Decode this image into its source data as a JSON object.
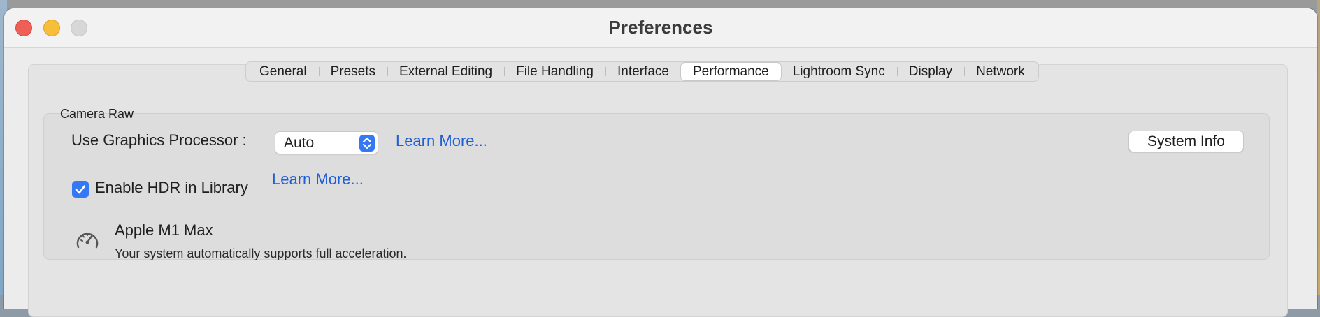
{
  "window": {
    "title": "Preferences"
  },
  "tabs": [
    {
      "label": "General"
    },
    {
      "label": "Presets"
    },
    {
      "label": "External Editing"
    },
    {
      "label": "File Handling"
    },
    {
      "label": "Interface"
    },
    {
      "label": "Performance",
      "active": true
    },
    {
      "label": "Lightroom Sync"
    },
    {
      "label": "Display"
    },
    {
      "label": "Network"
    }
  ],
  "camera_raw": {
    "group_label": "Camera Raw",
    "gpu_label": "Use Graphics Processor :",
    "gpu_select": {
      "selected": "Auto"
    },
    "gpu_learn_more": "Learn More...",
    "system_info_button": "System Info",
    "hdr_checkbox": {
      "label": "Enable HDR in Library",
      "checked": true
    },
    "hdr_learn_more": "Learn More...",
    "processor": {
      "icon": "gauge-icon",
      "name": "Apple M1 Max",
      "description": "Your system automatically supports full acceleration."
    }
  },
  "colors": {
    "accent": "#3478f6",
    "link": "#1f5fd6",
    "close": "#ee5f58",
    "minimize": "#f7be3a",
    "zoom": "#d7d7d7"
  }
}
